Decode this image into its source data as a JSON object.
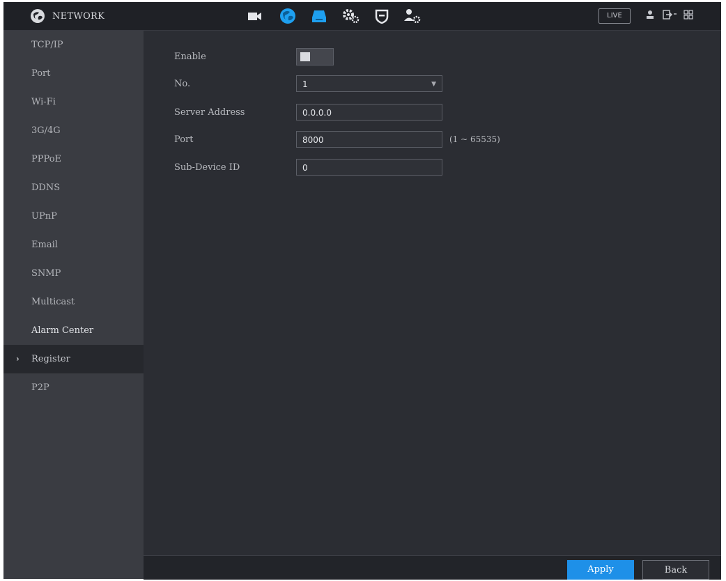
{
  "header": {
    "title": "NETWORK",
    "live_label": "LIVE",
    "nav_icons": [
      "camera-icon",
      "network-globe-icon",
      "storage-icon",
      "system-settings-icon",
      "security-shield-icon",
      "account-settings-icon"
    ],
    "utility_icons": [
      "user-icon",
      "logout-icon",
      "menu-grid-icon"
    ]
  },
  "sidebar": {
    "items": [
      {
        "label": "TCP/IP"
      },
      {
        "label": "Port"
      },
      {
        "label": "Wi-Fi"
      },
      {
        "label": "3G/4G"
      },
      {
        "label": "PPPoE"
      },
      {
        "label": "DDNS"
      },
      {
        "label": "UPnP"
      },
      {
        "label": "Email"
      },
      {
        "label": "SNMP"
      },
      {
        "label": "Multicast"
      },
      {
        "label": "Alarm Center"
      },
      {
        "label": "Register",
        "active": true
      },
      {
        "label": "P2P"
      }
    ]
  },
  "form": {
    "enable": {
      "label": "Enable",
      "value": "on"
    },
    "no": {
      "label": "No.",
      "value": "1"
    },
    "server_address": {
      "label": "Server Address",
      "value": "0.0.0.0"
    },
    "port": {
      "label": "Port",
      "value": "8000",
      "hint": "(1 ~ 65535)"
    },
    "sub_device_id": {
      "label": "Sub-Device ID",
      "value": "0"
    }
  },
  "footer": {
    "apply_label": "Apply",
    "back_label": "Back"
  },
  "colors": {
    "accent": "#1e90e8",
    "background": "#2b2d33",
    "sidebar": "#3a3c42",
    "topbar": "#1f2126"
  }
}
